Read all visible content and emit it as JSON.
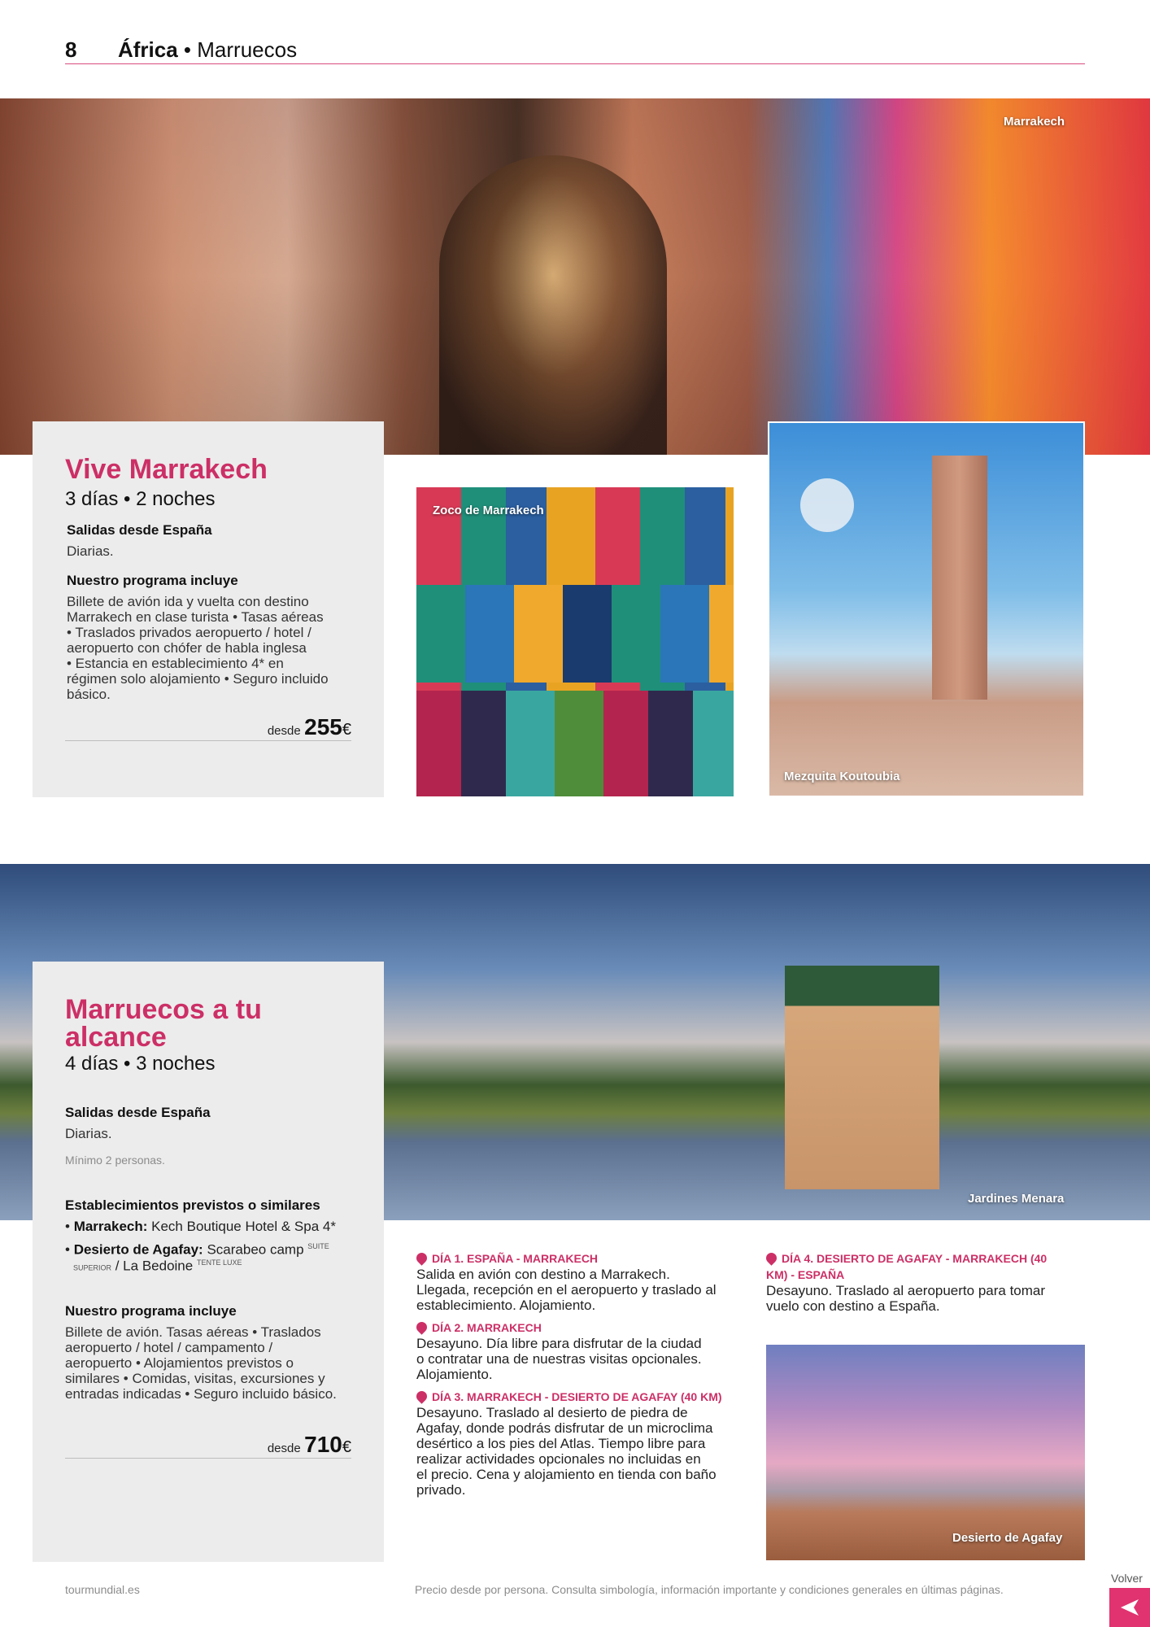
{
  "header": {
    "page_number": "8",
    "continent": "África",
    "separator": " • ",
    "country": "Marruecos"
  },
  "photos": {
    "hero1_caption": "Marrakech",
    "slippers_caption": "Zoco de Marrakech",
    "koutoubia_caption": "Mezquita Koutoubia",
    "hero2_caption": "Jardines Menara",
    "desert_caption": "Desierto de Agafay"
  },
  "trip1": {
    "title": "Vive Marrakech",
    "duration": "3 días • 2 noches",
    "departures_heading": "Salidas desde España",
    "departures_text": "Diarias.",
    "program_heading": "Nuestro programa incluye",
    "program_lines": [
      "Billete de avión ida y vuelta con destino",
      "Marrakech en clase turista • Tasas aéreas",
      "• Traslados privados aeropuerto / hotel /",
      "aeropuerto con chófer de habla inglesa",
      "• Estancia en establecimiento 4* en",
      "régimen solo alojamiento • Seguro incluido",
      "básico."
    ],
    "price_prefix": "desde",
    "price": "255",
    "currency": "€"
  },
  "trip2": {
    "title_line1": "Marruecos a tu",
    "title_line2": "alcance",
    "duration": "4 días • 3 noches",
    "departures_heading": "Salidas desde España",
    "departures_text": "Diarias.",
    "minimum": "Mínimo 2 personas.",
    "establishments_heading": "Establecimientos previstos o similares",
    "est1_city": "Marrakech:",
    "est1_hotel": "Kech Boutique Hotel & Spa 4*",
    "est2_city": "Desierto de Agafay:",
    "est2_hotel": "Scarabeo camp",
    "est2_sup1": "SUITE",
    "est2_sup2": "SUPERIOR",
    "est2_alt": " / La Bedoine",
    "est2_sup3": "TENTE LUXE",
    "bullet": "•",
    "program_heading": "Nuestro programa incluye",
    "program_lines": [
      "Billete de avión. Tasas aéreas • Traslados",
      "aeropuerto / hotel / campamento /",
      "aeropuerto • Alojamientos previstos o",
      "similares • Comidas, visitas, excursiones y",
      "entradas indicadas • Seguro incluido básico."
    ],
    "price_prefix": "desde",
    "price": "710",
    "currency": "€"
  },
  "itinerary": {
    "day1_title": "DÍA 1. ESPAÑA - MARRAKECH",
    "day1_lines": [
      "Salida en avión con destino a Marrakech.",
      "Llegada, recepción en el aeropuerto y traslado al",
      "establecimiento. Alojamiento."
    ],
    "day2_title": "DÍA 2. MARRAKECH",
    "day2_lines": [
      "Desayuno. Día libre para disfrutar de la ciudad",
      "o contratar una de nuestras visitas opcionales.",
      "Alojamiento."
    ],
    "day3_title": "DÍA 3. MARRAKECH - DESIERTO DE AGAFAY (40 KM)",
    "day3_lines": [
      "Desayuno. Traslado al desierto de piedra de",
      "Agafay, donde podrás disfrutar de un microclima",
      "desértico a los pies del Atlas. Tiempo libre para",
      "realizar actividades opcionales no incluidas en",
      "el precio. Cena y alojamiento en tienda con baño",
      "privado."
    ],
    "day4_title_line1": "DÍA 4. DESIERTO DE AGAFAY - MARRAKECH (40",
    "day4_title_line2": "KM) - ESPAÑA",
    "day4_lines": [
      "Desayuno. Traslado al aeropuerto para tomar",
      "vuelo con destino a España."
    ]
  },
  "footer": {
    "website": "tourmundial.es",
    "disclaimer": "Precio desde por persona. Consulta simbología, información importante y condiciones generales en últimas páginas.",
    "back_label": "Volver"
  },
  "colors": {
    "accent": "#cc2f66",
    "card_bg": "#ececec",
    "back_button": "#e0336f"
  },
  "icons": {
    "day_marker": "location-pin-icon",
    "back": "triangle-left-icon"
  }
}
